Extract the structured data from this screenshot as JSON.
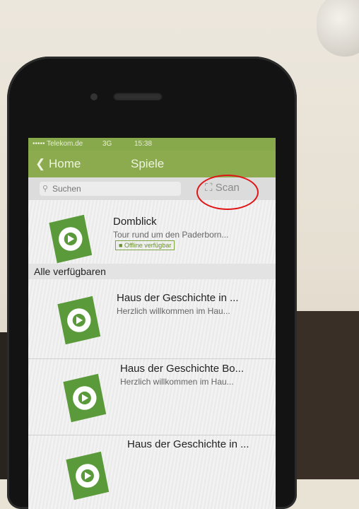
{
  "statusbar": {
    "carrier": "••••• Telekom.de",
    "network": "3G",
    "time": "15:38"
  },
  "navbar": {
    "back_label": "Home",
    "title": "Spiele"
  },
  "search": {
    "placeholder": "Suchen",
    "scan_label": "Scan"
  },
  "featured": {
    "title": "Domblick",
    "subtitle": "Tour rund um den Paderborn...",
    "badge": "Offline verfügbar"
  },
  "section_header": "Alle verfügbaren",
  "items": [
    {
      "title": "Haus der Geschichte in ...",
      "subtitle": "Herzlich willkommen im Hau..."
    },
    {
      "title": "Haus der Geschichte Bo...",
      "subtitle": "Herzlich willkommen im Hau..."
    },
    {
      "title": "Haus der Geschichte in ...",
      "subtitle": ""
    }
  ],
  "colors": {
    "accent": "#8bab4e",
    "logo_green": "#5a9a3a",
    "annotation": "#e01515"
  }
}
